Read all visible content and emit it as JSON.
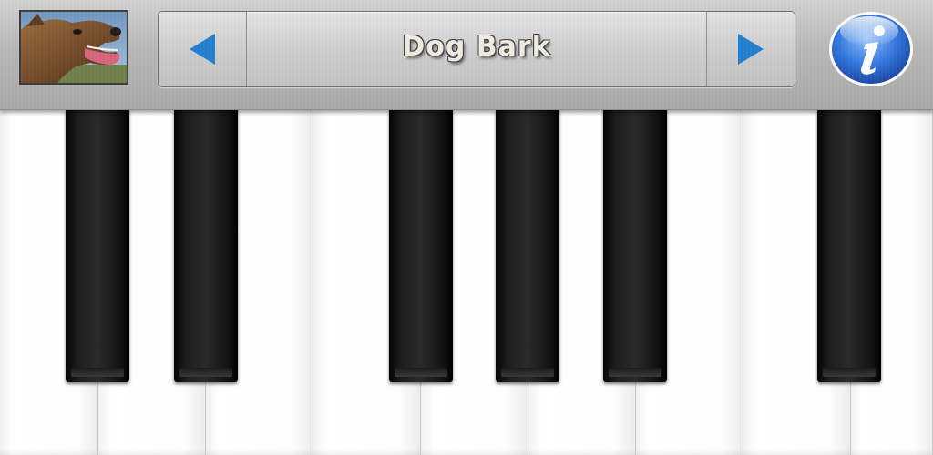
{
  "toolbar": {
    "thumbnail_icon": "dog-photo-icon",
    "prev_icon": "triangle-left-icon",
    "next_icon": "triangle-right-icon",
    "sound_name": "Dog Bark",
    "info_icon": "info-icon",
    "arrow_color": "#1f7fd0",
    "info_color": "#2a6fd8"
  },
  "piano": {
    "white_keys": [
      "white-key",
      "white-key",
      "white-key",
      "white-key",
      "white-key",
      "white-key",
      "white-key",
      "white-key",
      "white-key"
    ],
    "black_keys": [
      "black-key",
      "black-key",
      "black-key",
      "black-key",
      "black-key",
      "black-key"
    ]
  }
}
